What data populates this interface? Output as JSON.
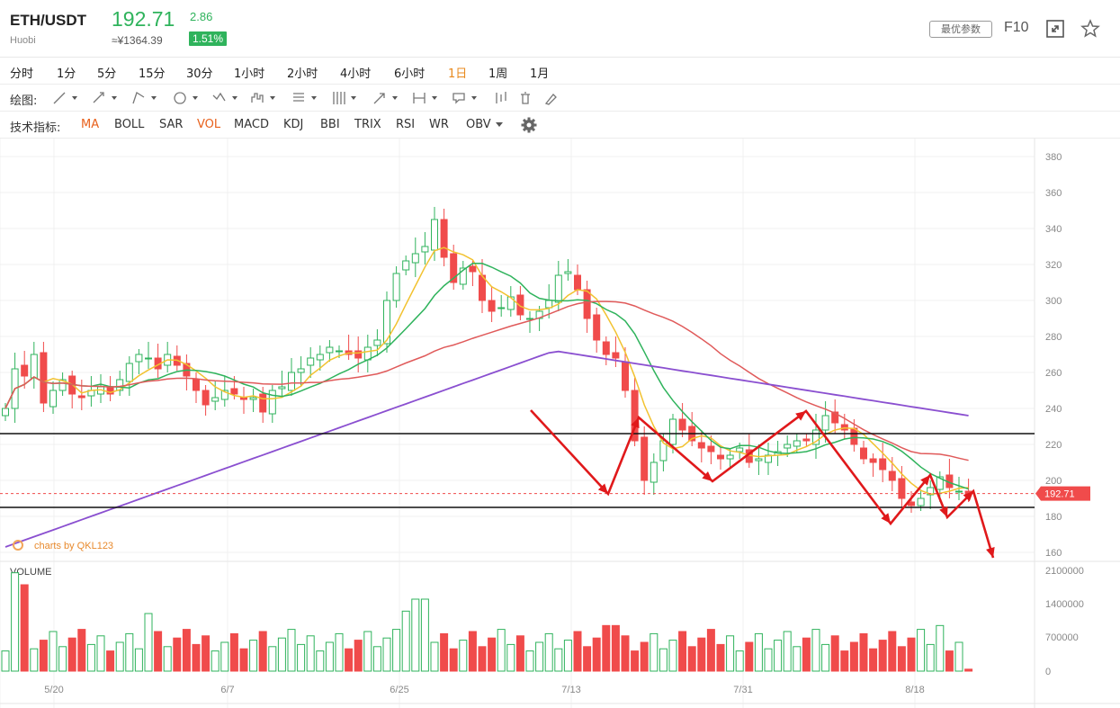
{
  "header": {
    "pair": "ETH/USDT",
    "exchange": "Huobi",
    "price": "192.71",
    "cny_price": "≈¥1364.39",
    "change": "2.86",
    "change_pct": "1.51%",
    "best_params_label": "最优参数",
    "f10_label": "F10",
    "icons": [
      "fullscreen-icon",
      "star-icon"
    ]
  },
  "periods": [
    {
      "label": "分时",
      "active": false
    },
    {
      "label": "1分",
      "active": false
    },
    {
      "label": "5分",
      "active": false
    },
    {
      "label": "15分",
      "active": false
    },
    {
      "label": "30分",
      "active": false
    },
    {
      "label": "1小时",
      "active": false
    },
    {
      "label": "2小时",
      "active": false
    },
    {
      "label": "4小时",
      "active": false
    },
    {
      "label": "6小时",
      "active": false
    },
    {
      "label": "1日",
      "active": true
    },
    {
      "label": "1周",
      "active": false
    },
    {
      "label": "1月",
      "active": false
    }
  ],
  "drawing": {
    "label": "绘图:",
    "tools": [
      "line-tool-icon",
      "ray-tool-icon",
      "channel-tool-icon",
      "shape-tool-icon",
      "wave-tool-icon",
      "pattern-tool-icon",
      "fib-tool-icon",
      "gann-tool-icon",
      "arrow-tool-icon",
      "measure-tool-icon",
      "text-tool-icon",
      "candle-tool-icon",
      "trash-icon",
      "pen-icon"
    ]
  },
  "indicators": {
    "label": "技术指标:",
    "items": [
      {
        "label": "MA",
        "on": true
      },
      {
        "label": "BOLL",
        "on": false
      },
      {
        "label": "SAR",
        "on": false
      },
      {
        "label": "VOL",
        "on": true
      },
      {
        "label": "MACD",
        "on": false
      },
      {
        "label": "KDJ",
        "on": false
      },
      {
        "label": "BBI",
        "on": false
      },
      {
        "label": "TRIX",
        "on": false
      },
      {
        "label": "RSI",
        "on": false
      },
      {
        "label": "WR",
        "on": false
      },
      {
        "label": "OBV",
        "on": false
      }
    ],
    "settings_icon": "gear-icon"
  },
  "chart_data": {
    "type": "candlestick",
    "watermark": "charts by QKL123",
    "current_price_tag": "192.71",
    "price_axis": [
      380,
      360,
      340,
      320,
      300,
      280,
      260,
      240,
      220,
      200,
      180,
      160
    ],
    "volume_label": "VOLUME",
    "volume_axis": [
      "2100000",
      "1400000",
      "700000",
      "0"
    ],
    "date_labels": [
      "5/20",
      "6/7",
      "6/25",
      "7/13",
      "7/31",
      "8/18"
    ],
    "colors": {
      "up": "#2fb35c",
      "down": "#f04b4b",
      "ma5": "#f2c230",
      "ma10": "#2fb35c",
      "ma30": "#e05a5a",
      "ma60": "#8a4fd0",
      "annot": "#e0191b"
    }
  }
}
